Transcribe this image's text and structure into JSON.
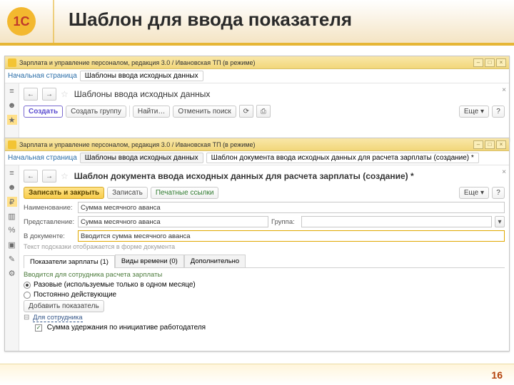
{
  "slide": {
    "title": "Шаблон для ввода показателя",
    "page_number": "16"
  },
  "win1": {
    "titlebar": "Зарплата и управление персоналом, редакция 3.0 / Ивановская ТП (в режиме)",
    "nav_home": "Начальная страница",
    "tab": "Шаблоны ввода исходных данных",
    "page_heading": "Шаблоны ввода исходных данных",
    "toolbar": {
      "create": "Создать",
      "group": "Создать группу",
      "find": "Найти…",
      "cancel_find": "Отменить поиск",
      "more": "Еще ▾",
      "help": "?"
    }
  },
  "win2": {
    "titlebar": "Зарплата и управление персоналом, редакция 3.0 / Ивановская ТП (в режиме)",
    "nav_home": "Начальная страница",
    "tab1": "Шаблоны ввода исходных данных",
    "tab2": "Шаблон документа ввода исходных данных для расчета зарплаты (создание) *",
    "page_heading": "Шаблон документа ввода исходных данных для расчета зарплаты (создание) *",
    "toolbar": {
      "save_close": "Записать и закрыть",
      "save": "Записать",
      "print_link": "Печатные ссылки",
      "more": "Еще ▾",
      "help": "?"
    },
    "fields": {
      "name_label": "Наименование:",
      "name_value": "Сумма месячного аванса",
      "display_label": "Представление:",
      "display_value": "Сумма месячного аванса",
      "group_label": "Группа:",
      "group_value": "",
      "here_label": "В документе:",
      "here_value": "Вводится сумма месячного аванса",
      "hint": "Текст подсказки отображается в форме документа"
    },
    "tabs": {
      "t1": "Показатели зарплаты (1)",
      "t2": "Виды времени (0)",
      "t3": "Дополнительно"
    },
    "section": "Вводится для сотрудника расчета зарплаты",
    "radio1": "Разовые (используемые только в одном месяце)",
    "radio2": "Постоянно действующие",
    "add_indicator": "Добавить показатель",
    "subhead": "Для сотрудника",
    "tree_item": "Сумма удержания по инициативе работодателя"
  }
}
